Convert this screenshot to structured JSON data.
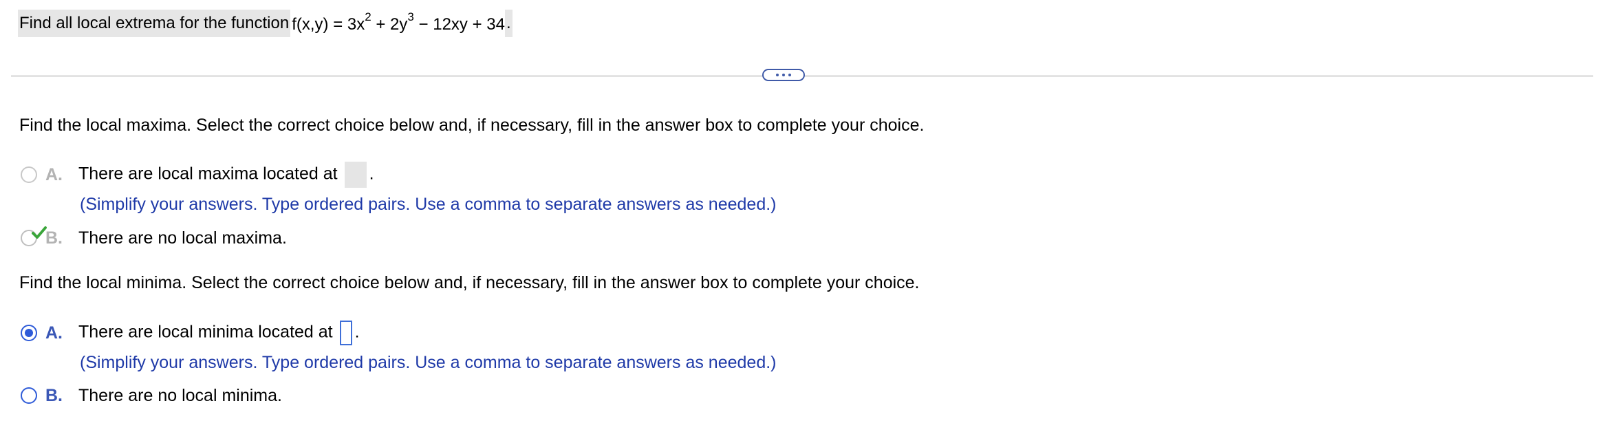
{
  "question": {
    "text": "Find all local extrema for the function ",
    "fx": "f(x,y)",
    "eq": " = 3x",
    "exp1": "2",
    "mid": " + 2y",
    "exp2": "3",
    "tail": " − 12xy + 34",
    "period": "."
  },
  "more_button": {
    "label": "more-options"
  },
  "maxima": {
    "prompt": "Find the local maxima. Select the correct choice below and, if necessary, fill in the answer box to complete your choice.",
    "choice_a": {
      "letter": "A.",
      "text_before": "There are local maxima located at",
      "text_after": ".",
      "hint": "(Simplify your answers. Type ordered pairs. Use a comma to separate answers as needed.)"
    },
    "choice_b": {
      "letter": "B.",
      "text": "There are no local maxima."
    }
  },
  "minima": {
    "prompt": "Find the local minima. Select the correct choice below and, if necessary, fill in the answer box to complete your choice.",
    "choice_a": {
      "letter": "A.",
      "text_before": "There are local minima located at",
      "text_after": ".",
      "hint": "(Simplify your answers. Type ordered pairs. Use a comma to separate answers as needed.)"
    },
    "choice_b": {
      "letter": "B.",
      "text": "There are no local minima."
    }
  },
  "colors": {
    "accent_blue": "#2e5bd8",
    "hint_blue": "#1f3aa8",
    "check_green": "#3aa53a",
    "disabled_grey": "#b3b3b3"
  }
}
